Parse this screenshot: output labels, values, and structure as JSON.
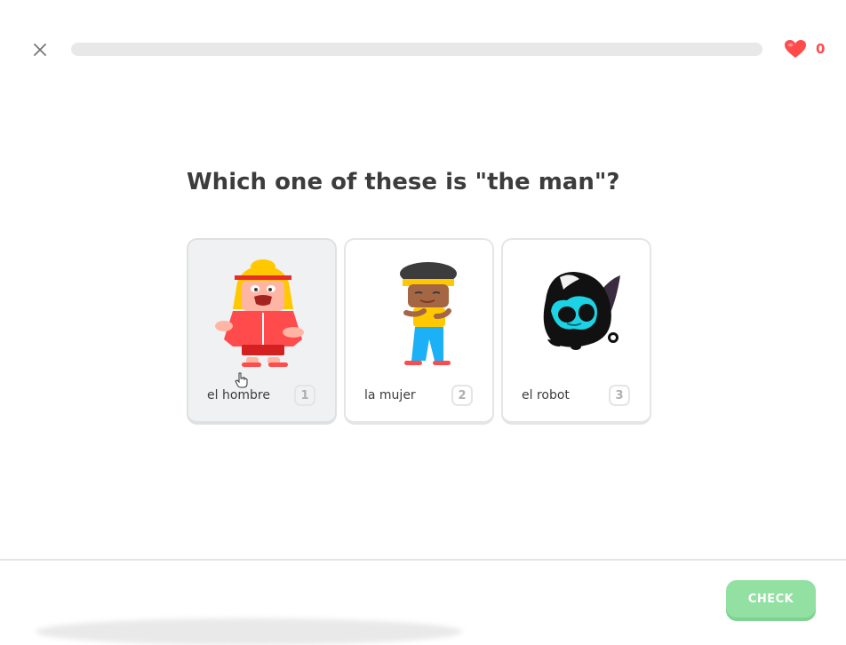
{
  "header": {
    "close_icon": "close-icon",
    "progress": 0,
    "hearts": {
      "icon": "heart-icon",
      "count": "0",
      "color": "#ff4b4b"
    }
  },
  "question": "Which one of these is \"the man\"?",
  "choices": [
    {
      "label": "el hombre",
      "key": "1",
      "image": "man-character"
    },
    {
      "label": "la mujer",
      "key": "2",
      "image": "woman-character"
    },
    {
      "label": "el robot",
      "key": "3",
      "image": "robot-character"
    }
  ],
  "footer": {
    "check_label": "CHECK",
    "check_color": "#93e0a3"
  }
}
